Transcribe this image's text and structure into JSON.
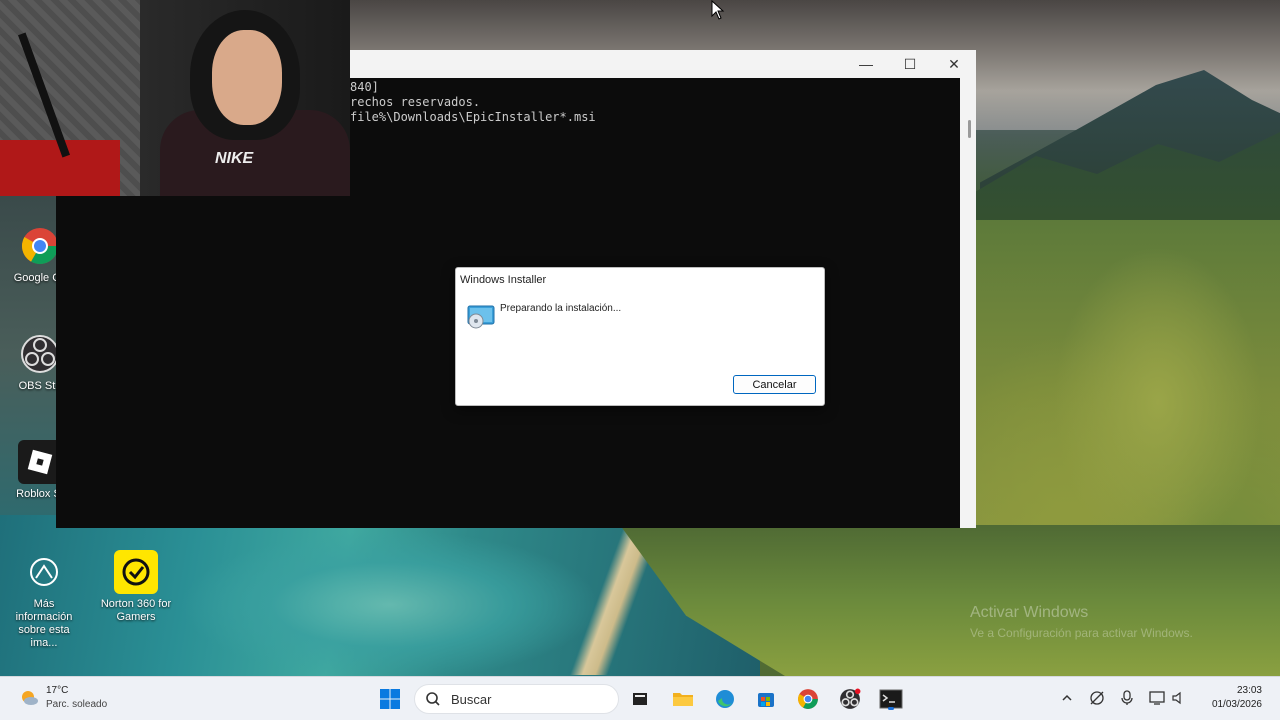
{
  "terminal": {
    "lines": [
      "840]",
      "rechos reservados.",
      "",
      "file%\\Downloads\\EpicInstaller*.msi"
    ],
    "minimize_glyph": "—",
    "maximize_glyph": "☐",
    "close_glyph": "✕"
  },
  "installer": {
    "title": "Windows Installer",
    "message": "Preparando la instalación...",
    "cancel_label": "Cancelar"
  },
  "webcam": {
    "logo_text": "NIKE"
  },
  "desktop_icons": [
    {
      "label": "Google Ch",
      "icon": "chrome-icon"
    },
    {
      "label": "OBS Stu",
      "icon": "obs-icon"
    },
    {
      "label": "Roblox St",
      "icon": "roblox-studio-icon"
    },
    {
      "label": "Más información sobre esta ima...",
      "icon": "info-icon"
    },
    {
      "label": "Norton 360 for Gamers",
      "icon": "norton-icon"
    }
  ],
  "watermark": {
    "line1": "Activar Windows",
    "line2": "Ve a Configuración para activar Windows."
  },
  "taskbar": {
    "weather_temp": "17°C",
    "weather_desc": "Parc. soleado",
    "search_placeholder": "Buscar",
    "apps": [
      "file-explorer-icon",
      "folder-icon",
      "edge-icon",
      "store-icon",
      "chrome-icon",
      "obs-icon",
      "terminal-icon"
    ],
    "tray_icons": [
      "chevron-up-icon",
      "network-off-icon",
      "microphone-icon",
      "display-icon",
      "volume-icon"
    ],
    "time": "23:03",
    "date": "01/03/2026"
  },
  "colors": {
    "accent": "#0067c0",
    "terminal_bg": "#0c0c0c",
    "taskbar_bg": "#eef1f6"
  }
}
